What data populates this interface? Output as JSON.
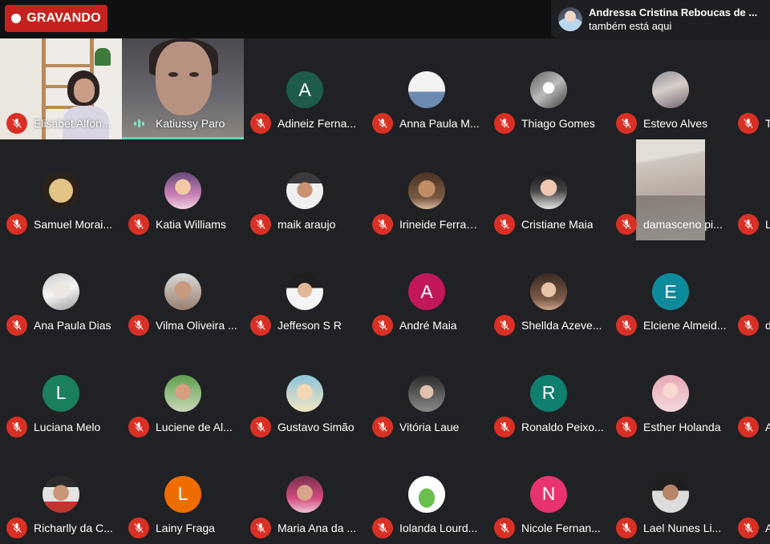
{
  "recording": {
    "label": "GRAVANDO"
  },
  "toast": {
    "name": "Andressa Cristina Reboucas de ...",
    "message": "também está aqui"
  },
  "colors": {
    "background": "#202124",
    "mute_red": "#d93025",
    "recording_red": "#c5221f",
    "speaking_teal": "#63d6b7"
  },
  "participants": [
    {
      "name": "Elisabet Alfon...",
      "tile": "video1",
      "muted": true
    },
    {
      "name": "Katiussy Paro",
      "tile": "video2",
      "muted": false,
      "speaking": true
    },
    {
      "name": "Adineiz Ferna...",
      "initial": "A",
      "color": "#1e5b4c",
      "muted": true
    },
    {
      "name": "Anna Paula M...",
      "photo": "photo-d",
      "muted": true
    },
    {
      "name": "Thiago Gomes",
      "photo": "photo-c",
      "muted": true
    },
    {
      "name": "Estevo Alves",
      "photo": "photo-a",
      "muted": true
    },
    {
      "name": "T",
      "initial": "",
      "color": "#202124",
      "muted": true
    },
    {
      "name": "Samuel Morai...",
      "photo": "photo-e",
      "muted": true
    },
    {
      "name": "Katia Williams",
      "photo": "photo-f",
      "muted": true
    },
    {
      "name": "maik araujo",
      "photo": "photo-g",
      "muted": true
    },
    {
      "name": "Irineide Ferraz ...",
      "photo": "photo-h",
      "muted": true
    },
    {
      "name": "Cristiane Maia",
      "photo": "photo-i",
      "muted": true
    },
    {
      "name": "damasceno pi...",
      "tile": "video3",
      "muted": true
    },
    {
      "name": "L",
      "initial": "",
      "color": "#202124",
      "muted": true
    },
    {
      "name": "Ana Paula Dias",
      "photo": "photo-j",
      "muted": true
    },
    {
      "name": "Vilma Oliveira ...",
      "photo": "photo-k",
      "muted": true
    },
    {
      "name": "Jeffeson S R",
      "photo": "photo-l",
      "muted": true
    },
    {
      "name": "André Maia",
      "initial": "A",
      "color": "#c2185b",
      "muted": true
    },
    {
      "name": "Shellda Azeve...",
      "photo": "photo-m",
      "muted": true
    },
    {
      "name": "Elciene Almeid...",
      "initial": "E",
      "color": "#0e8b9b",
      "muted": true
    },
    {
      "name": "d",
      "initial": "",
      "color": "#202124",
      "muted": true
    },
    {
      "name": "Luciana Melo",
      "initial": "L",
      "color": "#1a7f5f",
      "muted": true
    },
    {
      "name": "Luciene de Al...",
      "photo": "photo-o",
      "muted": true
    },
    {
      "name": "Gustavo Simão",
      "photo": "photo-p",
      "muted": true
    },
    {
      "name": "Vitória Laue",
      "photo": "photo-q",
      "muted": true
    },
    {
      "name": "Ronaldo Peixo...",
      "initial": "R",
      "color": "#0f7f70",
      "muted": true
    },
    {
      "name": "Esther Holanda",
      "photo": "photo-r",
      "muted": true
    },
    {
      "name": "A",
      "initial": "",
      "color": "#202124",
      "muted": true
    },
    {
      "name": "Richarlly da C...",
      "photo": "photo-s",
      "muted": true
    },
    {
      "name": "Lainy Fraga",
      "initial": "L",
      "color": "#ef6c00",
      "muted": true
    },
    {
      "name": "Maria Ana da ...",
      "photo": "photo-t",
      "muted": true
    },
    {
      "name": "Iolanda Lourd...",
      "photo": "photo-u",
      "muted": true
    },
    {
      "name": "Nicole Fernan...",
      "initial": "N",
      "color": "#e8336e",
      "muted": true
    },
    {
      "name": "Lael Nunes Li...",
      "photo": "photo-v",
      "muted": true
    },
    {
      "name": "A",
      "initial": "",
      "color": "#202124",
      "muted": true
    }
  ]
}
